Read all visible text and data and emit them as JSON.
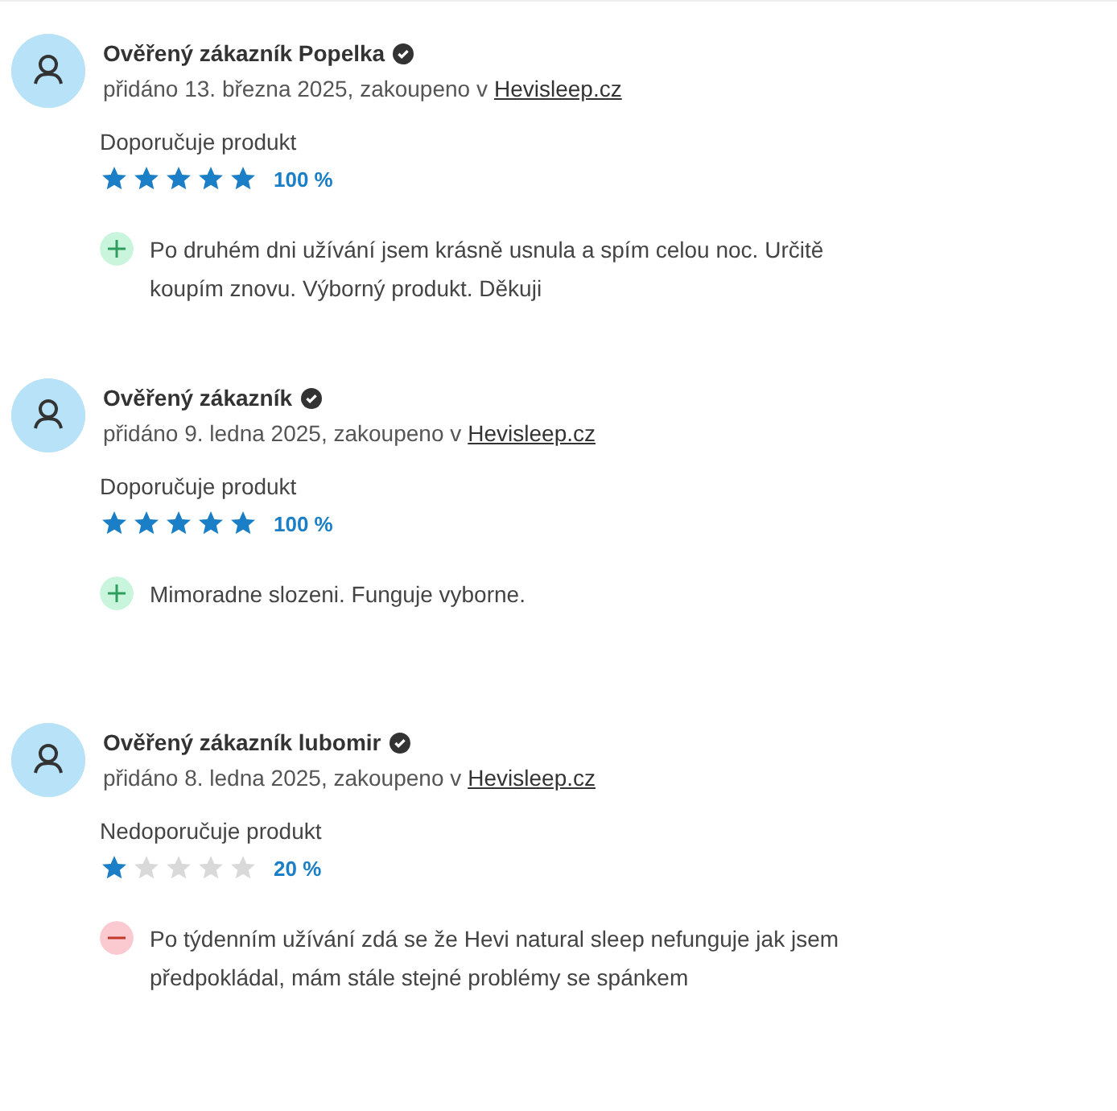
{
  "reviews": [
    {
      "author": "Ověřený zákazník Popelka",
      "meta": "přidáno 13. března 2025, zakoupeno v",
      "shop": "Hevisleep.cz",
      "verdict": "Doporučuje produkt",
      "stars": 5,
      "percent": "100 %",
      "comment": {
        "kind": "pro",
        "text": "Po druhém dni užívání jsem krásně usnula a spím celou noc. Určitě koupím znovu. Výborný produkt. Děkuji"
      }
    },
    {
      "author": "Ověřený zákazník",
      "meta": "přidáno 9. ledna 2025, zakoupeno v",
      "shop": "Hevisleep.cz",
      "verdict": "Doporučuje produkt",
      "stars": 5,
      "percent": "100 %",
      "comment": {
        "kind": "pro",
        "text": "Mimoradne slozeni. Funguje vyborne."
      }
    },
    {
      "author": "Ověřený zákazník lubomir",
      "meta": "přidáno 8. ledna 2025, zakoupeno v",
      "shop": "Hevisleep.cz",
      "verdict": "Nedoporučuje produkt",
      "stars": 1,
      "percent": "20 %",
      "comment": {
        "kind": "con",
        "text": "Po týdenním užívání zdá se že Hevi natural sleep nefunguje jak jsem předpokládal, mám stále stejné problémy se spánkem"
      }
    }
  ]
}
